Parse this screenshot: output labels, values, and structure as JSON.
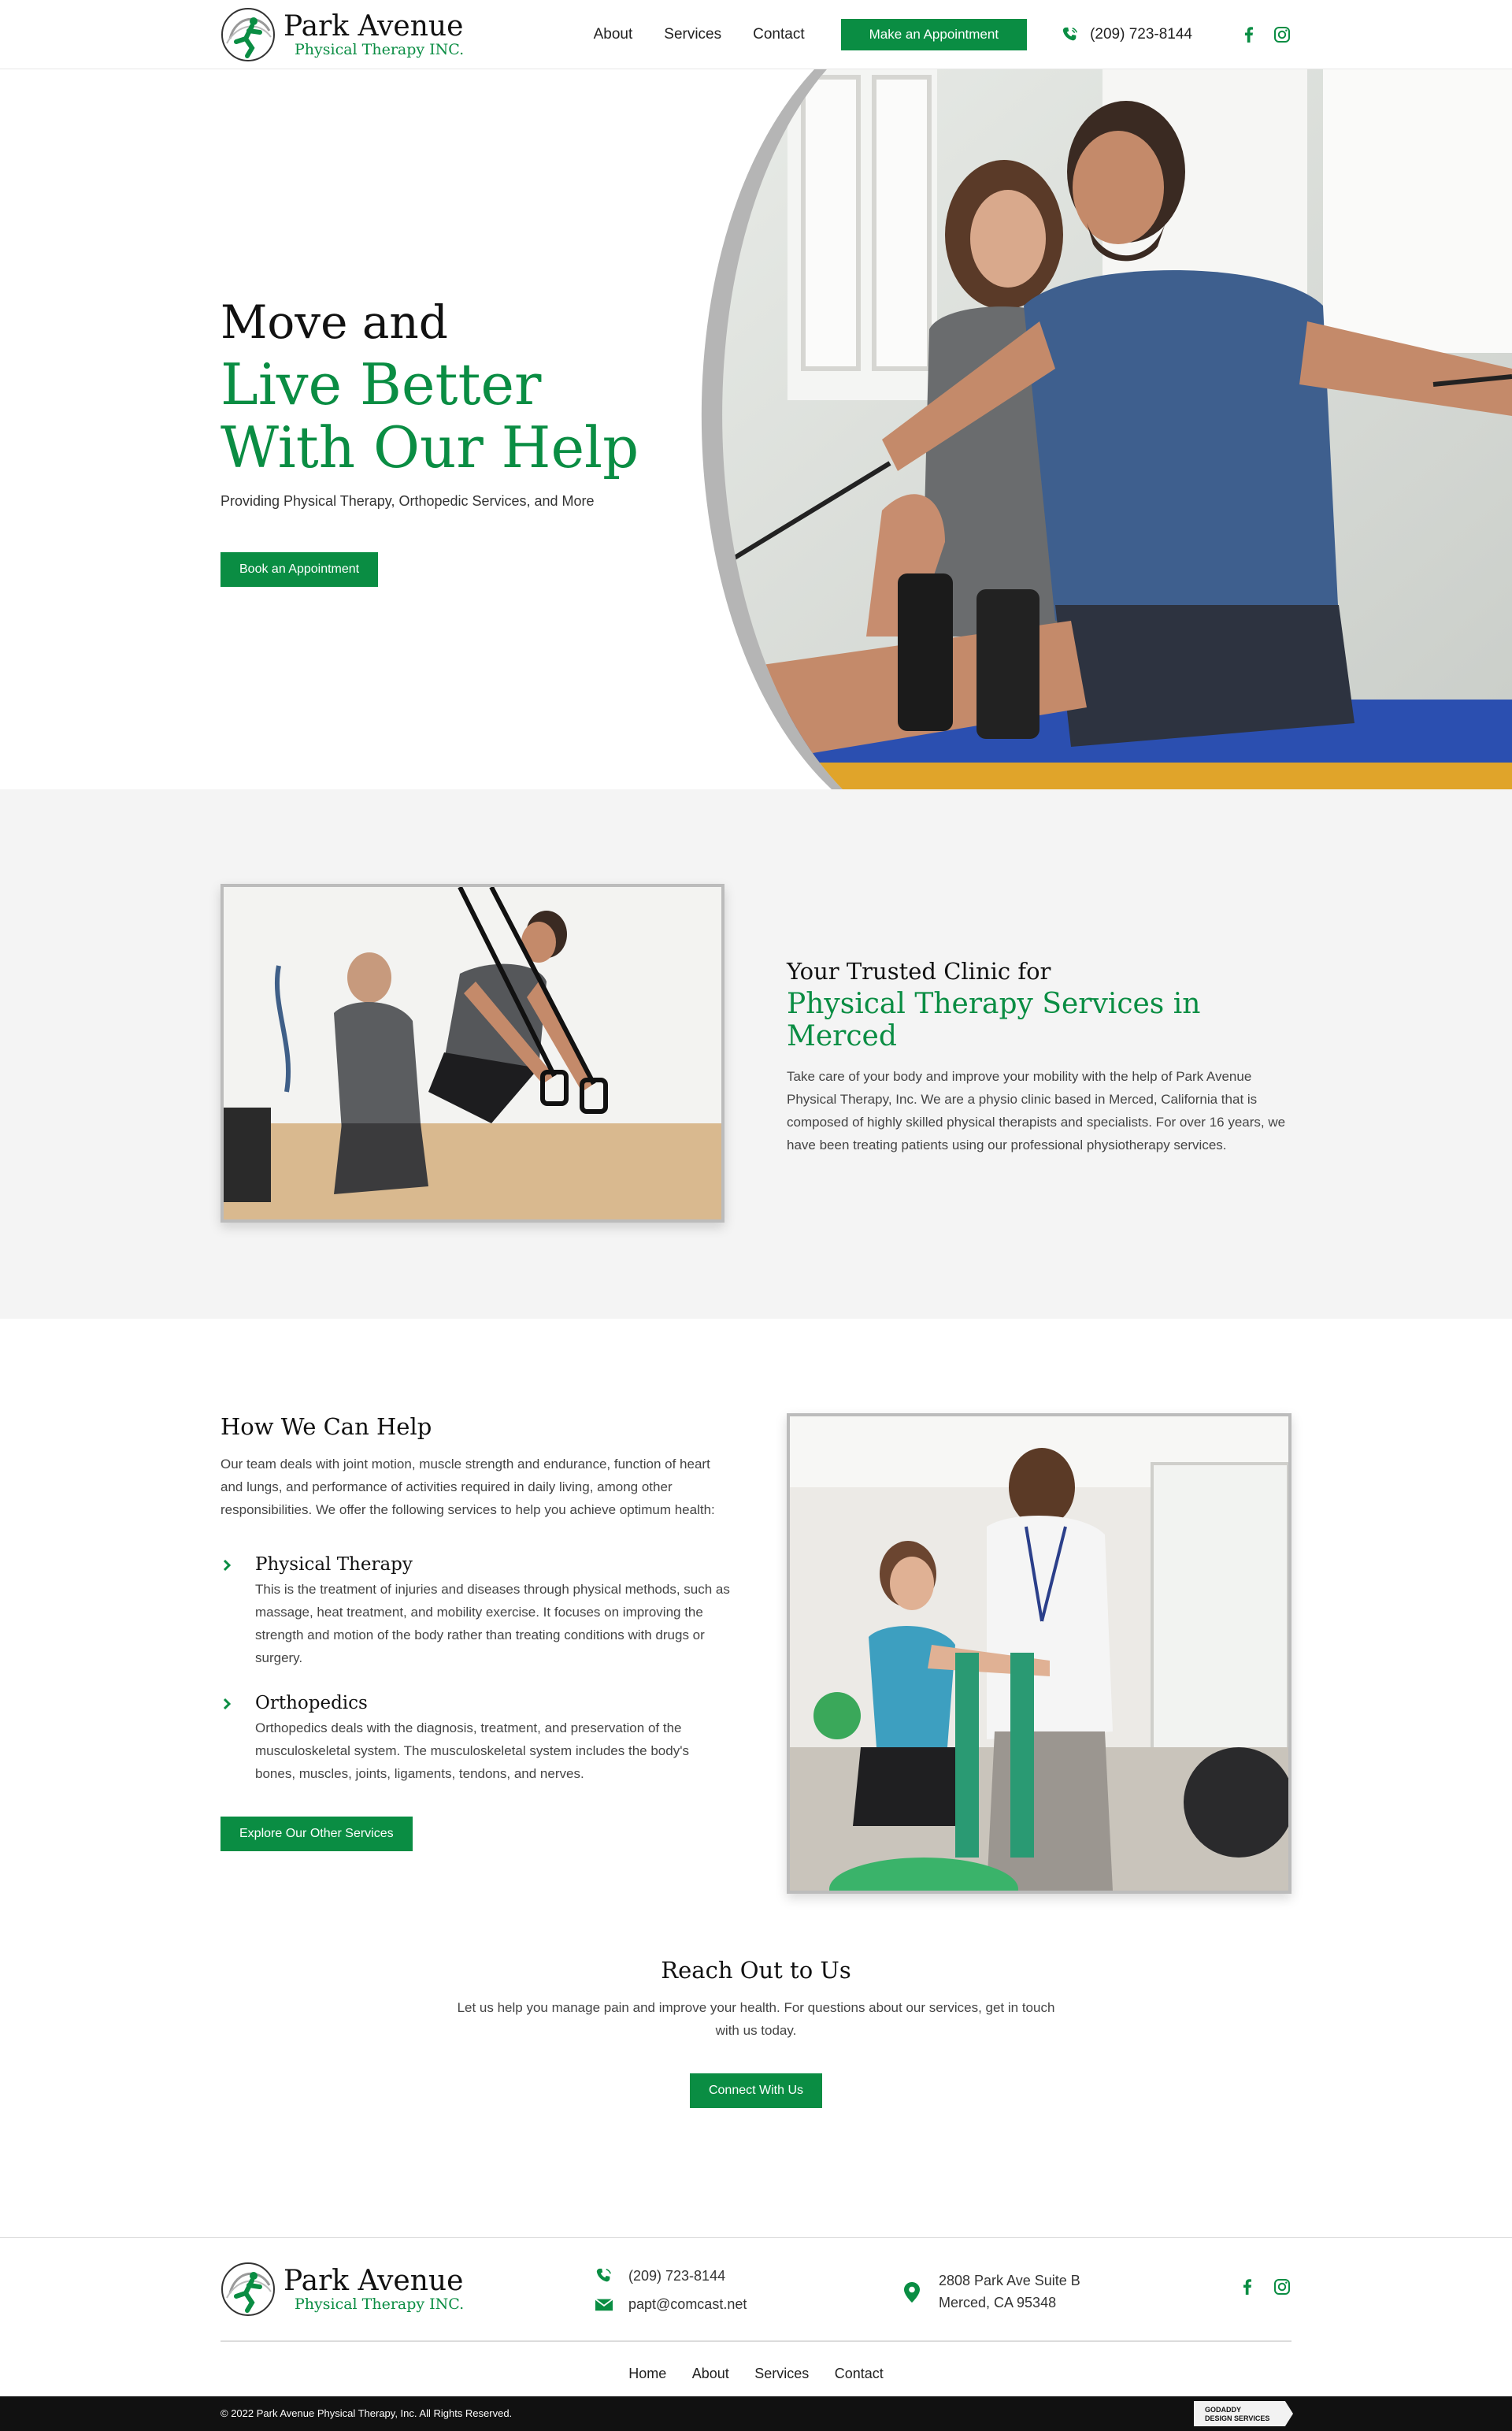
{
  "brand": {
    "name": "Park Avenue",
    "tagline": "Physical Therapy INC.",
    "green": "#0a8d43"
  },
  "nav": {
    "items": [
      "About",
      "Services",
      "Contact"
    ],
    "cta": "Make an Appointment",
    "phone": "(209) 723-8144"
  },
  "hero": {
    "line1": "Move and",
    "line2": "Live Better",
    "line3": "With Our Help",
    "subtitle": "Providing Physical Therapy, Orthopedic Services, and More",
    "button": "Book an Appointment"
  },
  "trusted": {
    "heading": "Your Trusted Clinic for",
    "heading_green": "Physical Therapy Services in Merced",
    "body": "Take care of your body and improve your mobility with the help of Park Avenue Physical Therapy, Inc. We are a physio clinic based in Merced, California that is composed of highly skilled physical therapists and specialists. For over 16 years, we have been treating patients using our professional physiotherapy services."
  },
  "help": {
    "heading": "How We Can Help",
    "intro": "Our team deals with joint motion, muscle strength and endurance, function of heart and lungs, and performance of activities required in daily living, among other responsibilities. We offer the following services to help you achieve optimum health:",
    "items": [
      {
        "title": "Physical Therapy",
        "body": "This is the treatment of injuries and diseases through physical methods, such as massage, heat treatment, and mobility exercise. It focuses on improving the strength and motion of the body rather than treating conditions with drugs or surgery."
      },
      {
        "title": "Orthopedics",
        "body": "Orthopedics deals with the diagnosis, treatment, and preservation of the musculoskeletal system. The musculoskeletal system includes the body's bones, muscles, joints, ligaments, tendons, and nerves."
      }
    ],
    "button": "Explore Our Other Services"
  },
  "reach": {
    "heading": "Reach Out to Us",
    "body": "Let us help you manage pain and improve your health. For questions about our services, get in touch with us today.",
    "button": "Connect With Us"
  },
  "footer": {
    "phone": "(209) 723-8144",
    "email": "papt@comcast.net",
    "address_line1": "2808 Park Ave Suite B",
    "address_line2": "Merced, CA 95348",
    "nav": [
      "Home",
      "About",
      "Services",
      "Contact"
    ],
    "copyright": "© 2022 Park Avenue Physical Therapy, Inc. All Rights Reserved.",
    "badge_line1": "GODADDY",
    "badge_line2": "DESIGN SERVICES"
  },
  "icons": {
    "phone": "phone-icon",
    "email": "envelope-icon",
    "address": "map-pin-icon",
    "facebook": "facebook-icon",
    "instagram": "instagram-icon",
    "chevron": "chevron-right-icon"
  }
}
